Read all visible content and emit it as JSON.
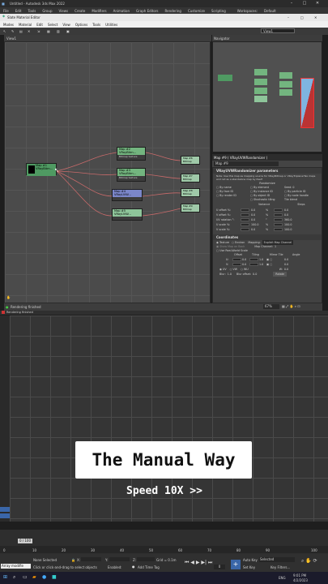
{
  "titlebar": {
    "title": "Untitled - Autodesk 3ds Max 2022"
  },
  "menubar": {
    "items": [
      "File",
      "Edit",
      "Tools",
      "Group",
      "Views",
      "Create",
      "Modifiers",
      "Animation",
      "Graph Editors",
      "Rendering",
      "Customize",
      "Scripting"
    ],
    "workspaces": "Workspaces:",
    "workspace_value": "Default"
  },
  "sme": {
    "title": "Slate Material Editor",
    "menu": [
      "Modes",
      "Material",
      "Edit",
      "Select",
      "View",
      "Options",
      "Tools",
      "Utilities"
    ],
    "view_selector": "View1",
    "view_tab": "View1",
    "nodes": [
      {
        "label": "Map #1 VRayBitm...",
        "sub": ""
      },
      {
        "label": "Map #2 VRayBitm...",
        "sub": "Bitmap texture"
      },
      {
        "label": "Map #3 VRayBitm...",
        "sub": "Bitmap texture"
      },
      {
        "label": "Map #4 VRayUVW...",
        "sub": ""
      },
      {
        "label": "Map #5 VRayUVW...",
        "sub": ""
      },
      {
        "label": "Map #6 Bitmap",
        "sub": ""
      },
      {
        "label": "Map #7 Bitmap",
        "sub": ""
      },
      {
        "label": "Map #8 Bitmap",
        "sub": ""
      },
      {
        "label": "Map #9 Bitmap",
        "sub": ""
      }
    ],
    "status": "Rendering finished",
    "zoom": "67%"
  },
  "navigator": {
    "title": "Navigator"
  },
  "params": {
    "title": "Map #9 ( VRayUVWRandomizer )",
    "name": "Map #9",
    "rollout1": "VRayUVWRandomizer parameters",
    "note": "Note: Use this map as mapping source for VRayBitmap or VRayTriplanarTex maps and not as a standalone map by itself",
    "randomize": "Randomize",
    "opts": [
      "By name",
      "By element",
      "Seed:",
      "By face ID",
      "By instance ID",
      "By particle ID",
      "By render ID",
      "By object ID",
      "By node handle",
      "",
      "Stochastic tiling",
      "Tile blend"
    ],
    "seed_value": "0",
    "col_variance": "Variance",
    "col_steps": "Steps",
    "rows": [
      {
        "label": "U offset %:",
        "v1": "0.0",
        "s1": "0.0"
      },
      {
        "label": "V offset %:",
        "v1": "0.0",
        "s1": "0.0"
      },
      {
        "label": "UV rotation °:",
        "v1": "0.0",
        "s1": "360.0"
      },
      {
        "label": "U scale %:",
        "v1": "100.0",
        "s1": "100.0"
      },
      {
        "label": "V scale %:",
        "v1": "0.0",
        "s1": "100.0"
      }
    ],
    "rollout2": "Coordinates",
    "texture": "Texture",
    "environ": "Environ",
    "mapping": "Mapping:",
    "mapping_value": "Explicit Map Channel",
    "show_map": "Show Map on Back",
    "map_channel": "Map Channel:",
    "map_channel_value": "1",
    "real_world": "Use Real-World Scale",
    "coord_cols": [
      "Offset",
      "Tiling",
      "Mirror Tile",
      "Angle"
    ],
    "coord_u": {
      "label": "U:",
      "offset": "0.0",
      "tiling": "1.0",
      "angle": "0.0"
    },
    "coord_v": {
      "label": "V:",
      "offset": "0.0",
      "tiling": "1.0",
      "angle": "0.0"
    },
    "uvw": [
      "UV",
      "VW",
      "WU"
    ],
    "w_label": "W:",
    "w_value": "0.0",
    "blur_label": "Blur:",
    "blur_value": "1.0",
    "blur_offset_label": "Blur offset:",
    "blur_offset_value": "0.0",
    "rotate": "Rotate"
  },
  "render": {
    "status": "Rendering finished"
  },
  "overlay": {
    "title": "The Manual Way",
    "speed": "Speed 10X >>"
  },
  "timeline": {
    "frame": "0 / 100",
    "ticks": [
      "0",
      "10",
      "20",
      "30",
      "40",
      "50",
      "60",
      "70",
      "80",
      "90",
      "100"
    ]
  },
  "bottom": {
    "script_label": "Array modifie",
    "selected": "None Selected",
    "hint": "Click or click-and-drag to select objects",
    "x": "X:",
    "y": "Y:",
    "z": "Z:",
    "grid": "Grid = 0.1m",
    "add_time_tag": "Add Time Tag",
    "enabled": "Enabled:",
    "auto_key": "Auto Key",
    "set_key": "Set Key",
    "selected_dd": "Selected",
    "key_filters": "Key Filters...",
    "frame_value": "0"
  },
  "taskbar": {
    "lang": "ENG",
    "time": "9:01 PM",
    "date": "4/2/2023"
  }
}
